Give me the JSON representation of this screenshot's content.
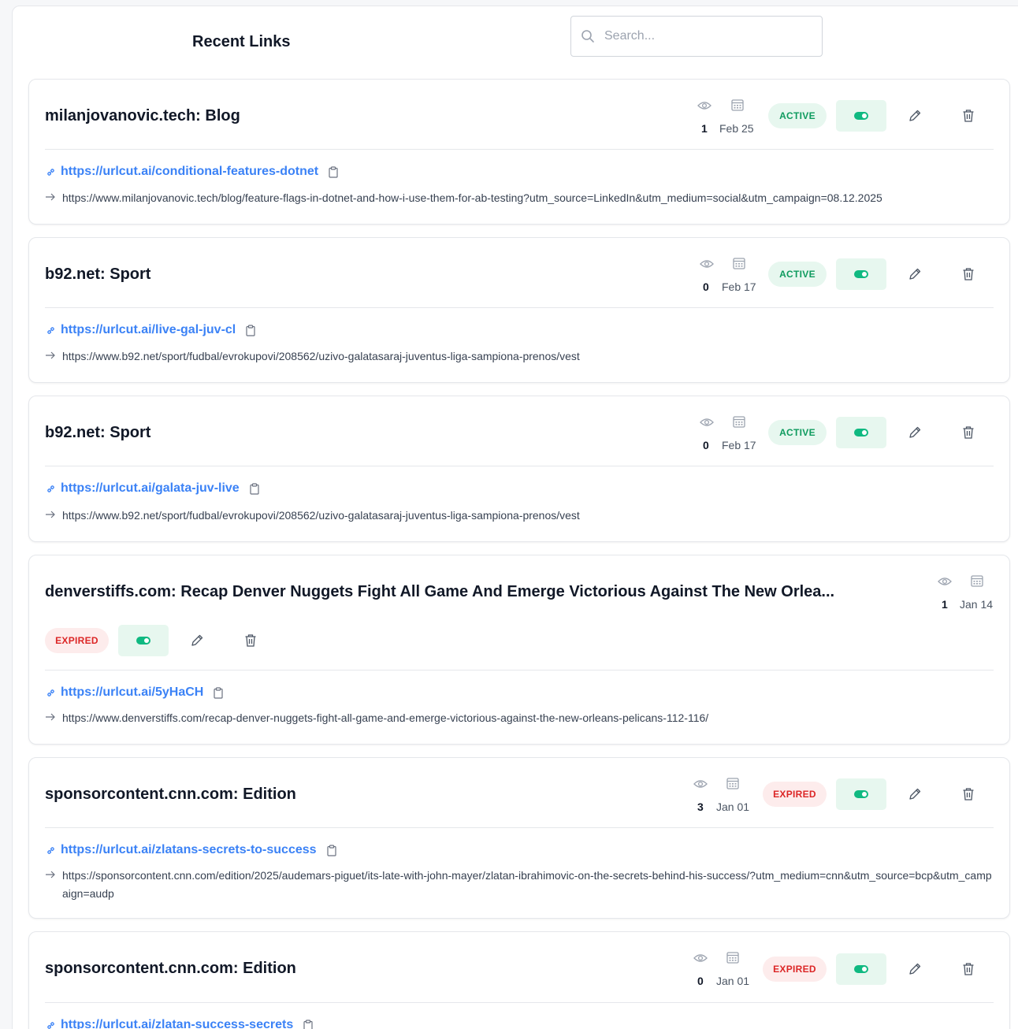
{
  "header": {
    "title": "Recent Links",
    "search_placeholder": "Search..."
  },
  "icons": {
    "views": "eye-icon",
    "date": "calendar-icon",
    "toggle": "toggle-icon",
    "edit": "pencil-icon",
    "delete": "trash-icon",
    "short_link": "link-icon",
    "copy": "clipboard-icon",
    "destination": "arrow-right-icon"
  },
  "colors": {
    "active_bg": "#e7f7ef",
    "active_text": "#0f9b5f",
    "expired_bg": "#fdecec",
    "expired_text": "#dc2626",
    "link": "#3b82f6"
  },
  "links": [
    {
      "title": "milanjovanovic.tech: Blog",
      "views": "1",
      "date": "Feb 25",
      "status": "ACTIVE",
      "short_url": "https://urlcut.ai/conditional-features-dotnet",
      "destination": "https://www.milanjovanovic.tech/blog/feature-flags-in-dotnet-and-how-i-use-them-for-ab-testing?utm_source=LinkedIn&utm_medium=social&utm_campaign=08.12.2025"
    },
    {
      "title": "b92.net: Sport",
      "views": "0",
      "date": "Feb 17",
      "status": "ACTIVE",
      "short_url": "https://urlcut.ai/live-gal-juv-cl",
      "destination": "https://www.b92.net/sport/fudbal/evrokupovi/208562/uzivo-galatasaraj-juventus-liga-sampiona-prenos/vest"
    },
    {
      "title": "b92.net: Sport",
      "views": "0",
      "date": "Feb 17",
      "status": "ACTIVE",
      "short_url": "https://urlcut.ai/galata-juv-live",
      "destination": "https://www.b92.net/sport/fudbal/evrokupovi/208562/uzivo-galatasaraj-juventus-liga-sampiona-prenos/vest"
    },
    {
      "title": "denverstiffs.com: Recap Denver Nuggets Fight All Game And Emerge Victorious Against The New Orlea...",
      "views": "1",
      "date": "Jan 14",
      "status": "EXPIRED",
      "short_url": "https://urlcut.ai/5yHaCH",
      "destination": "https://www.denverstiffs.com/recap-denver-nuggets-fight-all-game-and-emerge-victorious-against-the-new-orleans-pelicans-112-116/"
    },
    {
      "title": "sponsorcontent.cnn.com: Edition",
      "views": "3",
      "date": "Jan 01",
      "status": "EXPIRED",
      "short_url": "https://urlcut.ai/zlatans-secrets-to-success",
      "destination": "https://sponsorcontent.cnn.com/edition/2025/audemars-piguet/its-late-with-john-mayer/zlatan-ibrahimovic-on-the-secrets-behind-his-success/?utm_medium=cnn&utm_source=bcp&utm_campaign=audp"
    },
    {
      "title": "sponsorcontent.cnn.com: Edition",
      "views": "0",
      "date": "Jan 01",
      "status": "EXPIRED",
      "short_url": "https://urlcut.ai/zlatan-success-secrets",
      "destination": ""
    }
  ]
}
